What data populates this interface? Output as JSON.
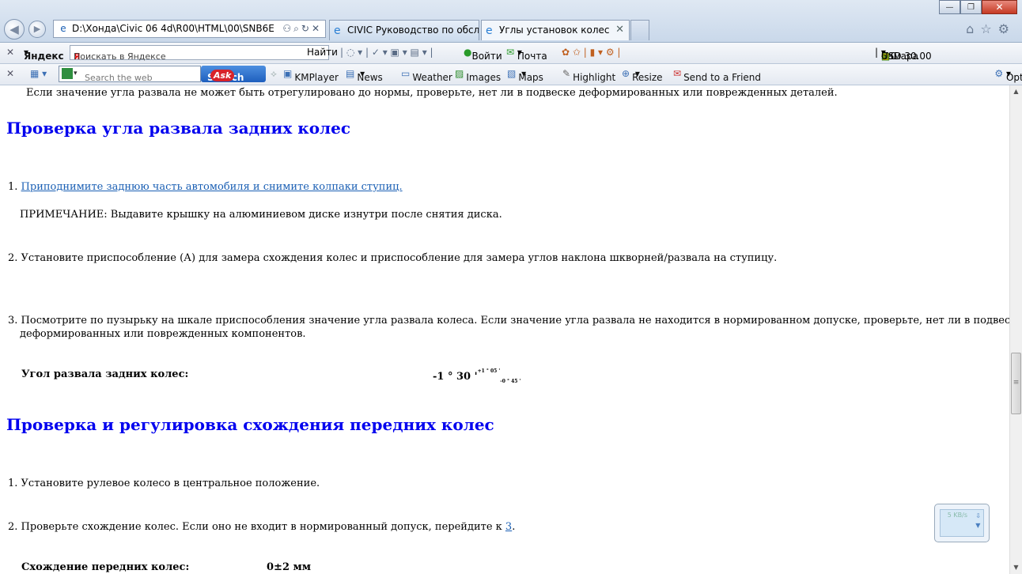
{
  "browser": {
    "address": "D:\\Хонда\\Civic 06 4d\\R00\\HTML\\00\\SNB6E",
    "tabs": [
      {
        "label": "CIVIC Руководство по обслуж..."
      },
      {
        "label": "Углы установок колес"
      }
    ]
  },
  "yandex_bar": {
    "brand": "Яндекс",
    "search_placeholder": "Поискать в Яндексе",
    "find_button": "Найти",
    "login": "Войти",
    "mail": "Почта",
    "city": "Самара",
    "temperature": "-10",
    "traffic": "5",
    "currency": "USD 30.00"
  },
  "ask_bar": {
    "search_placeholder": "Search the web",
    "search_button": "Search",
    "ask_logo": "Ask",
    "items": [
      "KMPlayer",
      "News",
      "Weather",
      "Images",
      "Maps",
      "Highlight",
      "Resize",
      "Send to a Friend"
    ],
    "options": "Options"
  },
  "content": {
    "intro": "Если значение угла развала не может быть отрегулировано до нормы, проверьте, нет ли в подвеске деформированных или поврежденных деталей.",
    "section1_title": "Проверка угла развала задних колес",
    "step1_num": "1.",
    "step1_link": "Приподнимите заднюю часть автомобиля и снимите колпаки ступиц.",
    "note": "ПРИМЕЧАНИЕ: Выдавите крышку на алюминиевом диске изнутри после снятия диска.",
    "step2": "2. Установите приспособление (А) для замера схождения колес и приспособление для замера углов наклона шкворней/развала на ступицу.",
    "step3_line1": "3. Посмотрите по пузырьку на шкале приспособления значение угла развала колеса. Если значение угла развала не находится в нормированном допуске, проверьте, нет ли в подвеске",
    "step3_line2": "деформированных или поврежденных компонентов.",
    "spec1_label": "Угол развала задних колес:",
    "spec1_value": "-1 ° 30 '",
    "spec1_tol_plus": "+1 ° 05 '",
    "spec1_tol_minus": "-0 ° 45 '",
    "section2_title": "Проверка и регулировка схождения передних колес",
    "s2_step1": "1. Установите рулевое колесо в центральное положение.",
    "s2_step2_text": "2. Проверьте схождение колес. Если оно не входит в нормированный допуск, перейдите к ",
    "s2_step2_link": "3",
    "s2_step2_end": ".",
    "spec2_label": "Схождение передних колес:",
    "spec2_value": "0±2 мм"
  },
  "widget": {
    "speed": "5 KB/s"
  }
}
